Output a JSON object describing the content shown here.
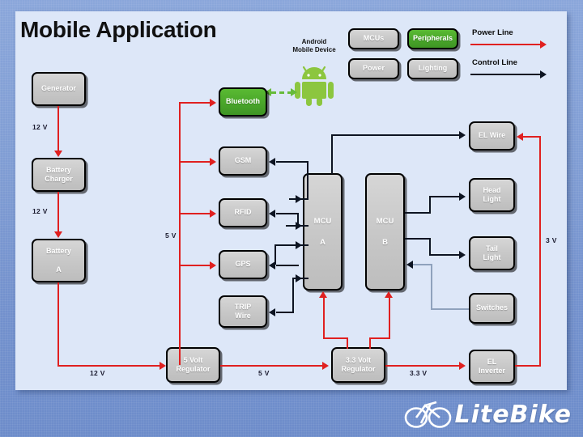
{
  "slide": {
    "title": "Mobile Application",
    "background_color": "#7c9ad4",
    "panel_color": "#dde7f8"
  },
  "legend": {
    "categories": [
      {
        "label": "MCUs",
        "color": "#c8c8c8"
      },
      {
        "label": "Peripherals",
        "color": "#49a62a"
      },
      {
        "label": "Power",
        "color": "#c8c8c8"
      },
      {
        "label": "Lighting",
        "color": "#c8c8c8"
      }
    ],
    "lines": [
      {
        "label": "Power Line",
        "color": "#e02020"
      },
      {
        "label": "Control Line",
        "color": "#0d1422"
      }
    ]
  },
  "android": {
    "caption_line1": "Android",
    "caption_line2": "Mobile Device",
    "icon": "android-robot",
    "color": "#8cc63f"
  },
  "nodes": {
    "generator": {
      "label": "Generator",
      "label2": "",
      "group": "power"
    },
    "battery_charger": {
      "label": "Battery",
      "label2": "Charger",
      "group": "power"
    },
    "battery_a": {
      "label": "Battery",
      "label2": "A",
      "group": "power"
    },
    "reg5": {
      "label": "5 Volt",
      "label2": "Regulator",
      "group": "power"
    },
    "reg33": {
      "label": "3.3 Volt",
      "label2": "Regulator",
      "group": "power"
    },
    "bluetooth": {
      "label": "Bluetooth",
      "label2": "",
      "group": "peripheral"
    },
    "gsm": {
      "label": "GSM",
      "label2": "",
      "group": "peripheral"
    },
    "rfid": {
      "label": "RFID",
      "label2": "",
      "group": "peripheral"
    },
    "gps": {
      "label": "GPS",
      "label2": "",
      "group": "peripheral"
    },
    "trip_wire": {
      "label": "TRIP",
      "label2": "Wire",
      "group": "peripheral"
    },
    "mcu_a": {
      "label": "MCU",
      "label2": "A",
      "group": "mcu"
    },
    "mcu_b": {
      "label": "MCU",
      "label2": "B",
      "group": "mcu"
    },
    "el_wire": {
      "label": "EL Wire",
      "label2": "",
      "group": "lighting"
    },
    "head_light": {
      "label": "Head",
      "label2": "Light",
      "group": "lighting"
    },
    "tail_light": {
      "label": "Tail",
      "label2": "Light",
      "group": "lighting"
    },
    "switches": {
      "label": "Switches",
      "label2": "",
      "group": "lighting"
    },
    "el_inverter": {
      "label": "EL",
      "label2": "Inverter",
      "group": "lighting"
    }
  },
  "voltage_labels": {
    "gen_to_charger": "12 V",
    "charger_to_battery": "12 V",
    "battery_to_reg5": "12 V",
    "peripheral_rail": "5 V",
    "reg5_to_reg33": "5 V",
    "reg33_to_inverter": "3.3 V",
    "inverter_rail": "3 V"
  },
  "logo": {
    "text": "LiteBike",
    "icon": "bicycle-icon"
  }
}
